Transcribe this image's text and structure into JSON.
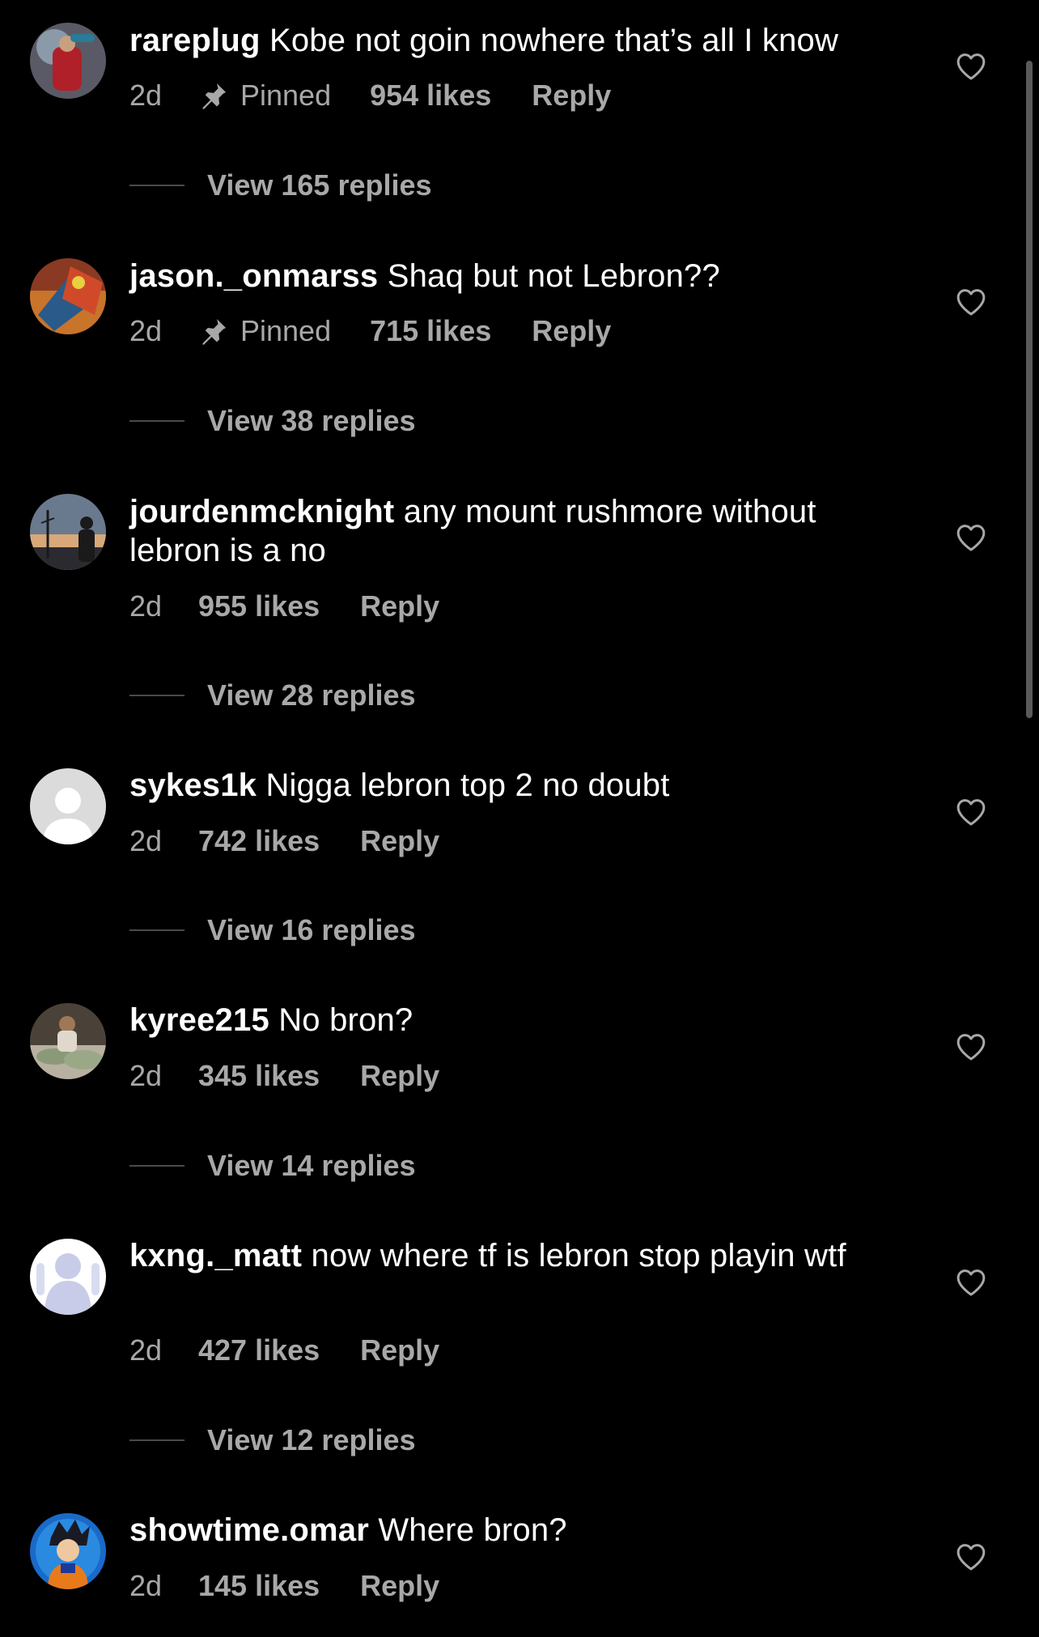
{
  "comments": [
    {
      "username": "rareplug",
      "text": "Kobe not goin nowhere that’s all I know",
      "time": "2d",
      "pinned_label": "Pinned",
      "likes": "954 likes",
      "reply_label": "Reply",
      "view_replies": "View 165 replies",
      "avatar": "photo-red-figure"
    },
    {
      "username": "jason._onmarss",
      "text": "Shaq but not Lebron??",
      "time": "2d",
      "pinned_label": "Pinned",
      "likes": "715 likes",
      "reply_label": "Reply",
      "view_replies": "View 38 replies",
      "avatar": "photo-colorful-art"
    },
    {
      "username": "jourdenmcknight",
      "text": "any mount rushmore without lebron is a no",
      "time": "2d",
      "likes": "955 likes",
      "reply_label": "Reply",
      "view_replies": "View 28 replies",
      "avatar": "photo-sunset-silhouette"
    },
    {
      "username": "sykes1k",
      "text": "Nigga lebron top 2 no doubt",
      "time": "2d",
      "likes": "742 likes",
      "reply_label": "Reply",
      "view_replies": "View 16 replies",
      "avatar": "default-user-avatar"
    },
    {
      "username": "kyree215",
      "text": "No bron?",
      "time": "2d",
      "likes": "345 likes",
      "reply_label": "Reply",
      "view_replies": "View 14 replies",
      "avatar": "photo-money-pile"
    },
    {
      "username": "kxng._matt",
      "text": "now where tf is lebron stop playin wtf",
      "time": "2d",
      "likes": "427 likes",
      "reply_label": "Reply",
      "view_replies": "View 12 replies",
      "avatar": "photo-white-silhouette"
    },
    {
      "username": "showtime.omar",
      "text": "Where bron?",
      "time": "2d",
      "likes": "145 likes",
      "reply_label": "Reply",
      "avatar": "photo-anime-character"
    }
  ],
  "icons": {
    "heart": "heart-outline-icon",
    "pin": "pin-icon"
  },
  "colors": {
    "background": "#000000",
    "primary_text": "#ffffff",
    "secondary_text": "#a8a8a8"
  }
}
